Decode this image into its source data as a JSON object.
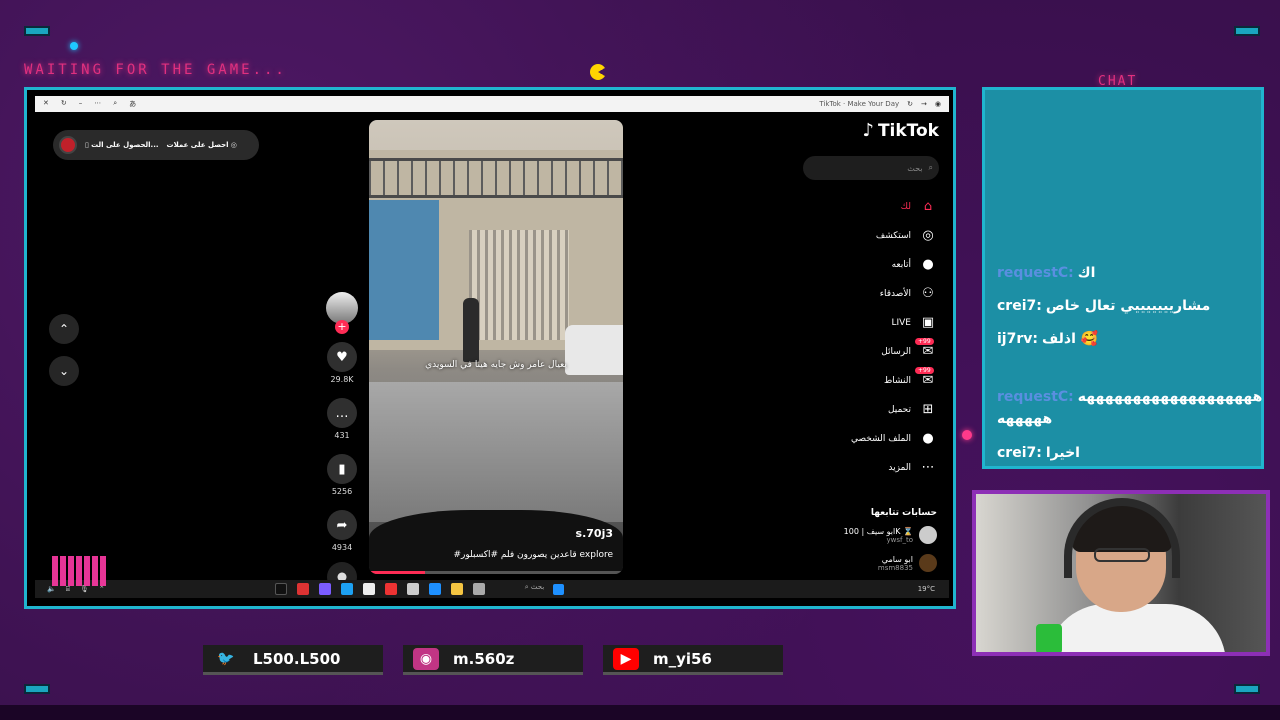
{
  "overlay": {
    "waiting_text": "WAITING FOR THE GAME...",
    "chat_title": "CHAT"
  },
  "browser": {
    "tab_title": "TikTok · Make Your Day"
  },
  "tiktok": {
    "logo": "TikTok",
    "search_placeholder": "بحث",
    "coins_pill": {
      "get_coins": "احصل على عملات",
      "get_app": "الحصول على الت..."
    },
    "nav": [
      {
        "label": "لك",
        "icon": "⌂",
        "name": "home",
        "active": true
      },
      {
        "label": "استكشف",
        "icon": "◎",
        "name": "explore",
        "active": false
      },
      {
        "label": "أتابعه",
        "icon": "●",
        "name": "following",
        "active": false
      },
      {
        "label": "الأصدقاء",
        "icon": "⚇",
        "name": "friends",
        "active": false
      },
      {
        "label": "LIVE",
        "icon": "▣",
        "name": "live",
        "active": false
      },
      {
        "label": "الرسائل",
        "icon": "✉",
        "name": "messages",
        "active": false,
        "badge": "+99"
      },
      {
        "label": "النشاط",
        "icon": "✉",
        "name": "activity",
        "active": false,
        "badge": "+99"
      },
      {
        "label": "تحميل",
        "icon": "⊞",
        "name": "upload",
        "active": false
      },
      {
        "label": "الملف الشخصي",
        "icon": "●",
        "name": "profile",
        "active": false
      },
      {
        "label": "المزيد",
        "icon": "⋯",
        "name": "more",
        "active": false
      }
    ],
    "following_title": "حسابات تتابعها",
    "following": [
      {
        "name": "ابو سيف | 100K ⌛",
        "handle": "ywsf_to"
      },
      {
        "name": "ابو سامي",
        "handle": "msm8835"
      }
    ],
    "video": {
      "overlay_caption": "يعيال عامر وش جايه هينا في السويدي",
      "author": "s.70j3",
      "description": "#قاعدين يصورون فلم #اكسبلور explore",
      "progress": 0.22
    },
    "actions": {
      "likes": "29.8K",
      "comments": "431",
      "saves": "5256",
      "shares": "4934"
    },
    "taskbar": {
      "search": "بحث",
      "weather": "19°C"
    }
  },
  "chat": [
    {
      "user": "requestC:",
      "text": "اك"
    },
    {
      "user": "crei7:",
      "text": "مشاريييييييي تعال خاص"
    },
    {
      "user": "ij7rv:",
      "text": "اذلف 🥰"
    },
    {
      "user": "requestC:",
      "text": "هههههههههههههههههههه هههههه"
    },
    {
      "user": "crei7:",
      "text": "اخيرا"
    }
  ],
  "socials": [
    {
      "platform": "twitter",
      "handle": "L500.L500",
      "color": "#1da1f2",
      "icon": "🐦"
    },
    {
      "platform": "instagram",
      "handle": "m.560z",
      "color": "#c13584",
      "icon": "◉"
    },
    {
      "platform": "youtube",
      "handle": "m_yi56",
      "color": "#ff0000",
      "icon": "▶"
    }
  ],
  "colors": {
    "accent_cyan": "#20b5cf",
    "accent_pink": "#e0307f",
    "tiktok_red": "#fe2c55",
    "background_purple": "#38104b"
  }
}
